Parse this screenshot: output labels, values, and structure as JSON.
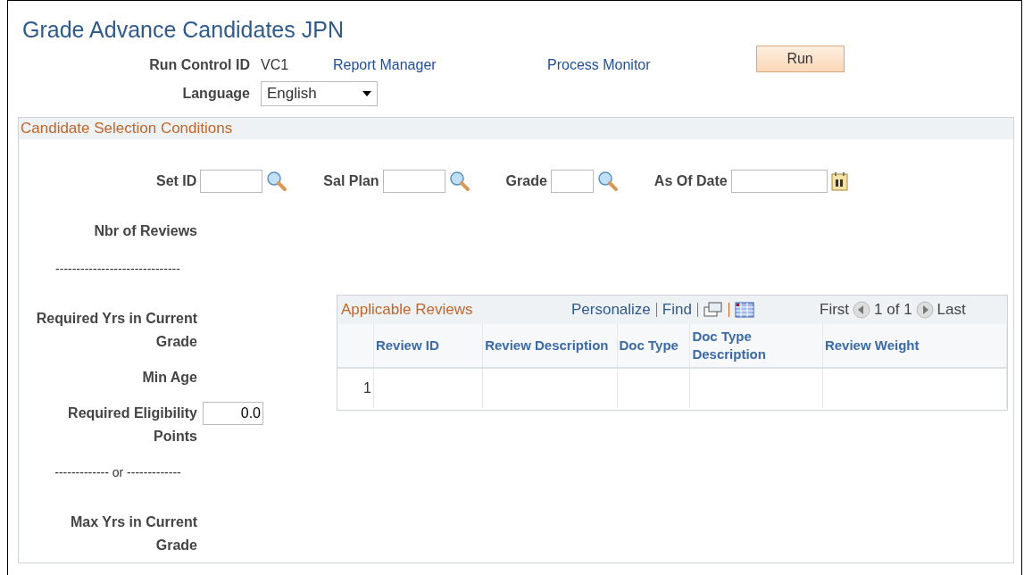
{
  "title": "Grade Advance Candidates JPN",
  "run_control": {
    "label": "Run Control ID",
    "value": "VC1"
  },
  "links": [
    "Report Manager",
    "Process Monitor"
  ],
  "run_button": "Run",
  "language": {
    "label": "Language",
    "value": "English"
  },
  "section": {
    "title": "Candidate Selection Conditions",
    "filters": [
      {
        "label": "Set ID",
        "kind": "lookup"
      },
      {
        "label": "Sal Plan",
        "kind": "lookup"
      },
      {
        "label": "Grade",
        "kind": "lookup"
      },
      {
        "label": "As Of Date",
        "kind": "date"
      }
    ],
    "criteria": [
      {
        "kind": "label",
        "label": "Nbr of Reviews"
      },
      {
        "kind": "divider",
        "label": "------------------------------"
      },
      {
        "kind": "label",
        "label": "Required Yrs in Current Grade"
      },
      {
        "kind": "label",
        "label": "Min Age"
      },
      {
        "kind": "input",
        "label": "Required Eligibility Points",
        "value": "0.0"
      },
      {
        "kind": "divider",
        "label": "------------- or -------------"
      },
      {
        "kind": "label",
        "label": "Max Yrs in Current Grade"
      }
    ],
    "grid": {
      "title": "Applicable Reviews",
      "toolbar": [
        "Personalize",
        "Find"
      ],
      "nav": {
        "first": "First",
        "count": "1 of 1",
        "last": "Last"
      },
      "columns": [
        "Review ID",
        "Review Description",
        "Doc Type",
        "Doc Type Description",
        "Review Weight"
      ],
      "rows": [
        {
          "number": "1"
        }
      ]
    }
  }
}
